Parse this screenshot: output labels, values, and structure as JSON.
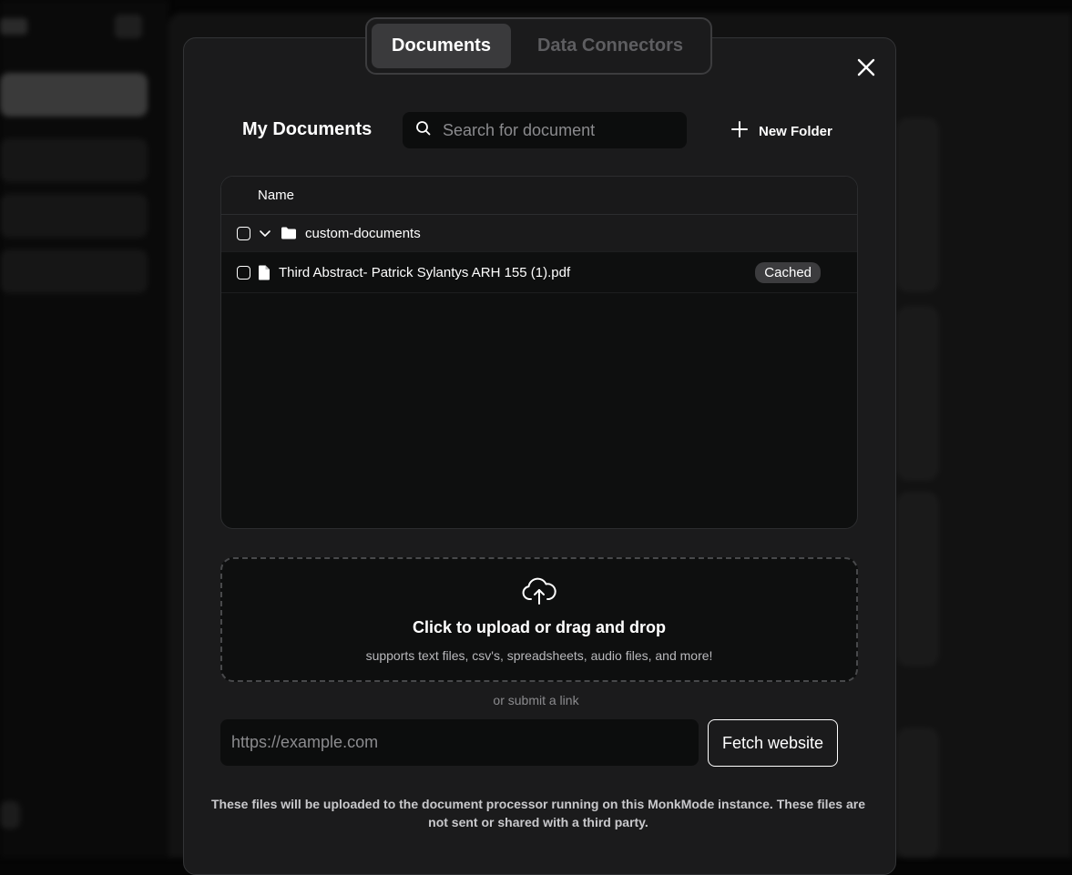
{
  "tabs": [
    {
      "label": "Documents",
      "active": true
    },
    {
      "label": "Data Connectors",
      "active": false
    }
  ],
  "header": {
    "title": "My Documents",
    "search_placeholder": "Search for document",
    "new_folder_label": "New Folder"
  },
  "table": {
    "column_name": "Name",
    "rows": [
      {
        "type": "folder",
        "name": "custom-documents",
        "expanded": true,
        "badge": ""
      },
      {
        "type": "file",
        "name": "Third Abstract- Patrick Sylantys ARH 155 (1).pdf",
        "badge": "Cached"
      }
    ]
  },
  "upload": {
    "title": "Click to upload or drag and drop",
    "subtitle": "supports text files, csv's, spreadsheets, audio files, and more!",
    "or_link": "or submit a link",
    "url_placeholder": "https://example.com",
    "fetch_label": "Fetch website"
  },
  "footer": {
    "note": "These files will be uploaded to the document processor running on this MonkMode instance. These files are not sent or shared with a third party."
  },
  "colors": {
    "modal_bg": "#1b1b1c",
    "panel_bg": "#0e0f0f",
    "active_tab": "#3a3a3c",
    "badge_bg": "#3c3c3e",
    "muted_text": "#8b8b8e"
  }
}
